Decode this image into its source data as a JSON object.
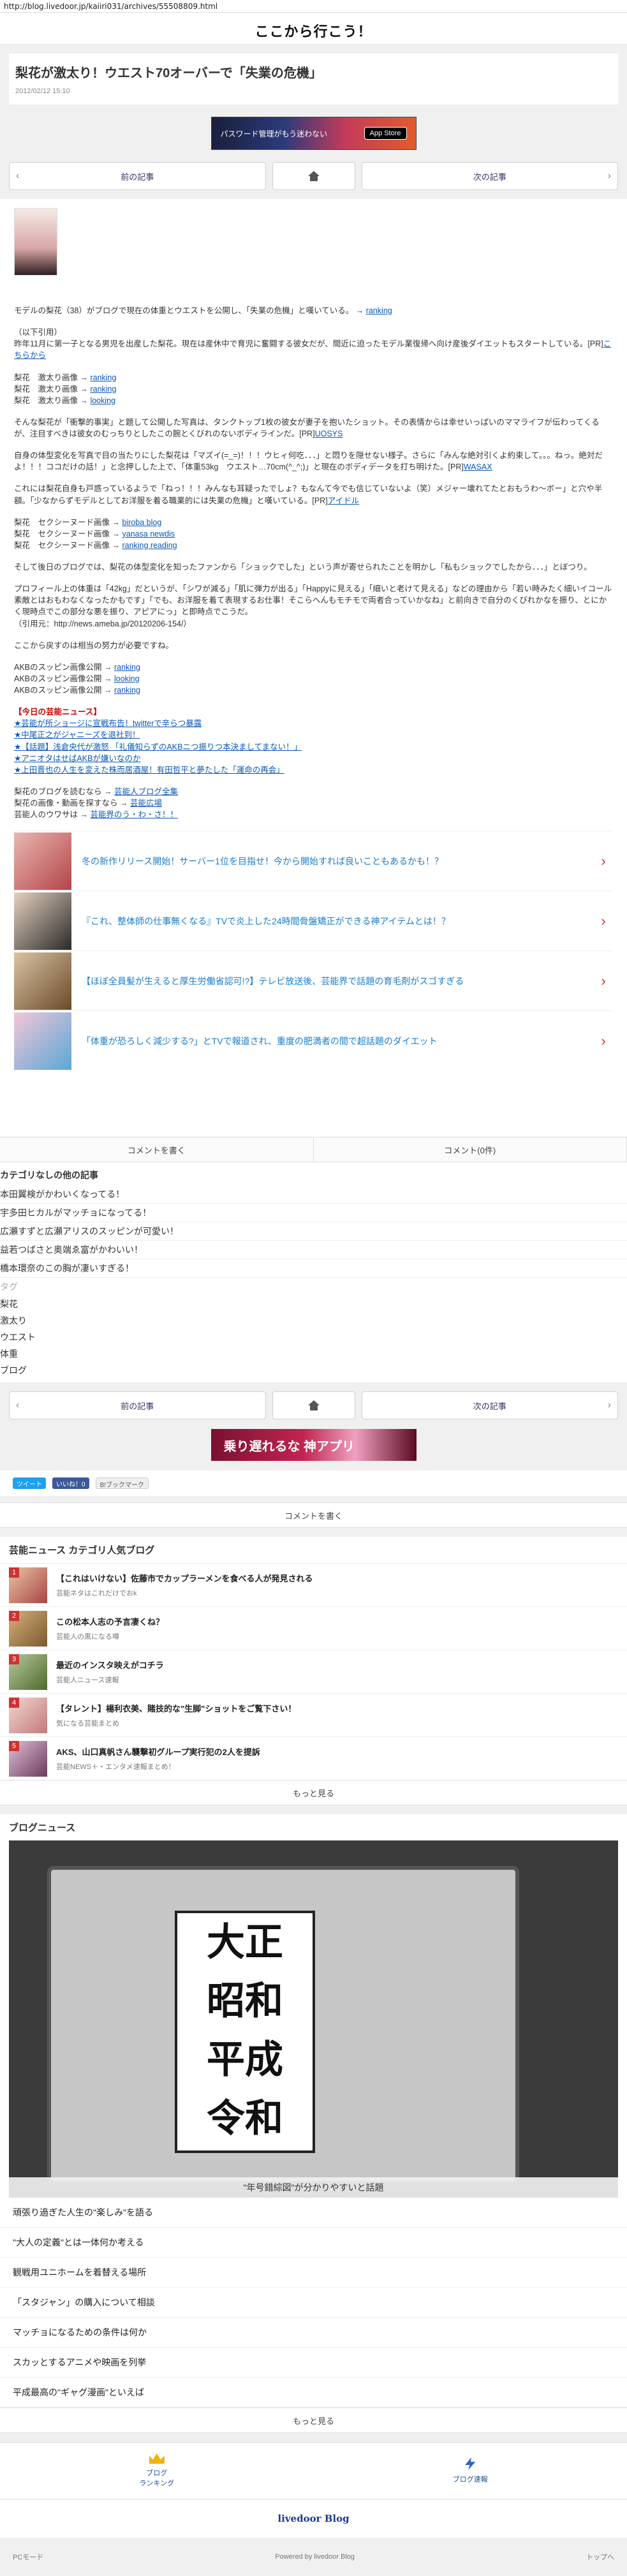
{
  "url": "http://blog.livedoor.jp/kaiiri031/archives/55508809.html",
  "blog_title": "ここから行こう！",
  "post": {
    "title": "梨花が激太り！ウエスト70オーバーで「失業の危機」",
    "date": "2012/02/12 15:10"
  },
  "ad_top": {
    "text": "パスワード管理がもう迷わない",
    "badge": "App Store"
  },
  "nav": {
    "prev": "前の記事",
    "next": "次の記事"
  },
  "article": {
    "p1": "モデルの梨花（38）がブログで現在の体重とウエストを公開し、「失業の危機」と嘆いている。 → ",
    "p1_link": "ranking",
    "p2a": "（以下引用）",
    "p2b": "昨年11月に第一子となる男児を出産した梨花。現在は産休中で育児に奮闘する彼女だが、間近に迫ったモデル業復帰へ向け産後ダイエットもスタートしている。[PR]",
    "p2_link": "こちらから",
    "links1": [
      {
        "label": "梨花　激太り画像 → ",
        "link": "ranking"
      },
      {
        "label": "梨花　激太り画像 → ",
        "link": "ranking"
      },
      {
        "label": "梨花　激太り画像 → ",
        "link": "looking"
      }
    ],
    "p3": "そんな梨花が「衝撃的事実」と題して公開した写真は、タンクトップ1枚の彼女が妻子を抱いたショット。その表情からは幸せいっぱいのママライフが伝わってくるが、注目すべきは彼女のむっちりとしたこの腕とくびれのないボディラインだ。[PR]",
    "p3_link": "UOSYS",
    "p4": "自身の体型変化を写真で目の当たりにした梨花は「マズイ(=_=)！！！ウヒィ何吃．．．」と悶りを隠せない様子。さらに「みんな絶対引くよ約束して。。。ねっ。絶対だよ！！！ココだけの話！」と念押しした上で、「体重53kg　ウエスト…70cm(^_^;)」と現在のボディデータを打ち明けた。[PR]",
    "p4_link": "WASAX",
    "p5": "これには梨花自身も戸惑っているようで「ねっ！！！みんなも耳疑ったでしょ？もなんて今でも信じていないよ（笑）メジャー壊れてたとおもうわ〜ボー」と穴や半額。「少なからずモデルとしてお洋服を着る職業的には失業の危機」と嘆いている。[PR]",
    "p5_link": "アイドル",
    "links2": [
      {
        "label": "梨花　セクシーヌード画像 → ",
        "link": "biroba blog"
      },
      {
        "label": "梨花　セクシーヌード画像 → ",
        "link": "yanasa newdis"
      },
      {
        "label": "梨花　セクシーヌード画像 → ",
        "link": "ranking reading"
      }
    ],
    "p6": "そして後日のブログでは、梨花の体型変化を知ったファンから「ショックでした」という声が寄せられたことを明かし「私もショックでしたから．．．」とぼつり。",
    "p7": "プロフィール上の体重は「42kg」だというが、「シワが減る」「肌に弾力が出る」「Happyに見える」「細いと老けて見える」などの理由から「若い時みたく細いイコール素敵とはおもわなくなったかもです」「でも、お洋服を着て表現するお仕事！そこらへんもモチモで両者合っていかなね」と前向きで自分のくびれかなを振り、とにかく現時点でこの部分な悪を振り、アピアにっ」と即時点でこうだ。",
    "p7b": "（引用元：http://news.ameba.jp/20120206-154/）",
    "p8": "ここから戻すのは相当の努力が必要ですね。",
    "links3": [
      {
        "label": "AKBのスッピン画像公開 → ",
        "link": "ranking"
      },
      {
        "label": "AKBのスッピン画像公開 → ",
        "link": "looking"
      },
      {
        "label": "AKBのスッピン画像公開 → ",
        "link": "ranking"
      }
    ],
    "news_title": "【今日の芸能ニュース】",
    "news": [
      "★芸能が所ショージに宣戦布告！twitterで辛らつ暴露",
      "★中尾正之がジャニーズを退社到！",
      "★【話題】浅倉央代が激怒 「礼儀知らずのAKBニつ振りつ本決ましてまない！」",
      "★アニオタはせばAKBが嫌いなのか",
      "★上田晋也の人生を変えた株而居酒屋！有田哲平と夢たした「運命の再会」"
    ],
    "links4": [
      {
        "label": "梨花のブログを読むなら → ",
        "link": "芸能人ブログ全集"
      },
      {
        "label": "梨花の画像・動画を探すなら → ",
        "link": "芸能広場"
      },
      {
        "label": "芸能人のウワサは → ",
        "link": "芸能界のう・わ・さ！！"
      }
    ]
  },
  "recommended": [
    {
      "text": "冬の新作リリース開始！サーバー1位を目指せ！今から開始すれば良いこともあるかも！？"
    },
    {
      "text": "『これ、整体師の仕事無くなる』TVで炎上した24時間骨盤矯正ができる神アイテムとは！？"
    },
    {
      "text": "【ほぼ全員髪が生えると厚生労働省認可!?】テレビ放送後、芸能界で話題の育毛剤がスゴすぎる"
    },
    {
      "text": "「体重が恐ろしく減少する?」とTVで報道され、重度の肥満者の間で超話題のダイエット"
    }
  ],
  "comment_bar": {
    "write": "コメントを書く",
    "count": "コメント(0件)"
  },
  "categories": {
    "head": "カテゴリなしの他の記事",
    "items": [
      "本田翼検がかわいくなってる！",
      "宇多田ヒカルがマッチョになってる！",
      "広瀬すずと広瀬アリスのスッピンが可愛い！",
      "益若つばさと奥端ゑ富がかわいい！",
      "橋本環奈のこの胸が凄いすぎる！"
    ],
    "tag_head": "タグ",
    "tags": [
      "梨花",
      "激太り",
      "ウエスト",
      "体重",
      "ブログ"
    ]
  },
  "ad_mid": {
    "text": "乗り遅れるな 神アプリ"
  },
  "share": {
    "tweet": "ツイート",
    "like": "いいね！0",
    "hatena": "B!ブックマーク"
  },
  "write_comment": "コメントを書く",
  "popular": {
    "title": "芸能ニュース カテゴリ人気ブログ",
    "items": [
      {
        "num": "1",
        "title": "【これはいけない】佐藤市でカップラーメンを食べる人が発見される",
        "src": "芸能ネタはこれだけでおk"
      },
      {
        "num": "2",
        "title": "この松本人志の予言凄くね？",
        "src": "芸能人の黒になる噂"
      },
      {
        "num": "3",
        "title": "最近のインスタ映えがコチラ",
        "src": "芸能人ニュース速報"
      },
      {
        "num": "4",
        "title": "【タレント】楊利衣美、賭技的な\"生脚\"ショットをご覧下さい！",
        "src": "気になる芸能まとめ"
      },
      {
        "num": "5",
        "title": "AKS、山口真帆さん襲撃初グループ実行犯の2人を提訴",
        "src": "芸能NEWS＋・エンタメ速報まとめ！"
      }
    ],
    "more": "もっと見る"
  },
  "blog_news": {
    "title": "ブログニュース",
    "hero_words": [
      "大正",
      "昭和",
      "平成",
      "令和"
    ],
    "hero_caption": "\"年号錯綜図\"が分かりやすいと話題",
    "items": [
      "頑張り過ぎた人生の\"楽しみ\"を語る",
      "\"大人の定義\"とは一体何か考える",
      "観戦用ユニホームを着替える場所",
      "「スタジャン」の購入について相談",
      "マッチョになるための条件は何か",
      "スカッとするアニメや映画を列挙",
      "平成最高の\"ギャグ漫画\"といえば"
    ],
    "more": "もっと見る"
  },
  "footer": {
    "ranking": "ブログ\nランキング",
    "speed": "ブログ速報",
    "logo": "livedoor Blog",
    "pc_mode": "PCモード",
    "powered": "Powered by livedoor Blog",
    "top": "トップへ"
  }
}
